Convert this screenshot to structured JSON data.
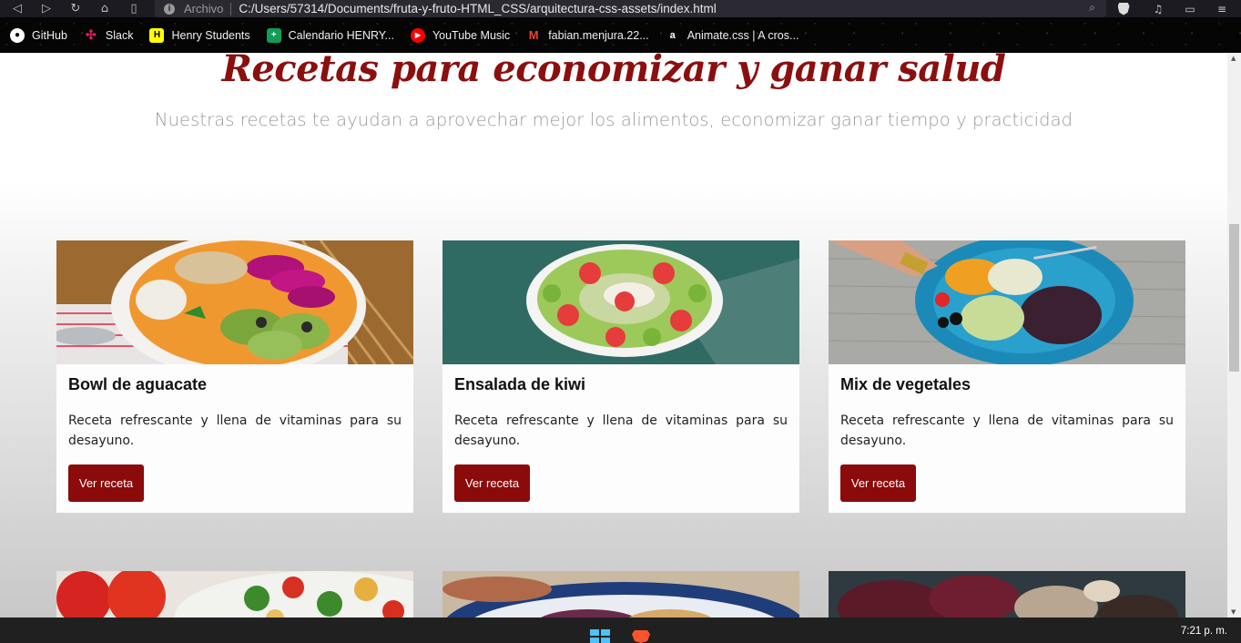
{
  "browser": {
    "url_protocol": "Archivo",
    "url": "C:/Users/57314/Documents/fruta-y-fruto-HTML_CSS/arquitectura-css-assets/index.html"
  },
  "bookmarks": [
    {
      "label": "GitHub",
      "icon": "github-icon",
      "color": "#ffffff"
    },
    {
      "label": "Slack",
      "icon": "slack-icon",
      "color": "#e01e5a"
    },
    {
      "label": "Henry Students",
      "icon": "henry-icon",
      "color": "#ffff00"
    },
    {
      "label": "Calendario HENRY...",
      "icon": "sheets-icon",
      "color": "#0f9d58"
    },
    {
      "label": "YouTube Music",
      "icon": "youtube-music-icon",
      "color": "#ff0000"
    },
    {
      "label": "fabian.menjura.22...",
      "icon": "gmail-icon",
      "color": "#ea4335"
    },
    {
      "label": "Animate.css | A cros...",
      "icon": "animate-icon",
      "color": "#050505"
    }
  ],
  "hero": {
    "title": "Recetas para economizar y ganar salud",
    "subtitle": "Nuestras recetas te ayudan a aprovechar mejor los alimentos, economizar ganar tiempo y practicidad"
  },
  "cards": [
    {
      "title": "Bowl de aguacate",
      "text": "Receta refrescante y llena de vitaminas para su desayuno.",
      "button": "Ver receta"
    },
    {
      "title": "Ensalada de kiwi",
      "text": "Receta refrescante y llena de vitaminas para su desayuno.",
      "button": "Ver receta"
    },
    {
      "title": "Mix de vegetales",
      "text": "Receta refrescante y llena de vitaminas para su desayuno.",
      "button": "Ver receta"
    }
  ],
  "taskbar": {
    "clock": "7:21 p. m."
  },
  "colors": {
    "accent": "#8b0a0a",
    "title": "#8b0f0f"
  }
}
